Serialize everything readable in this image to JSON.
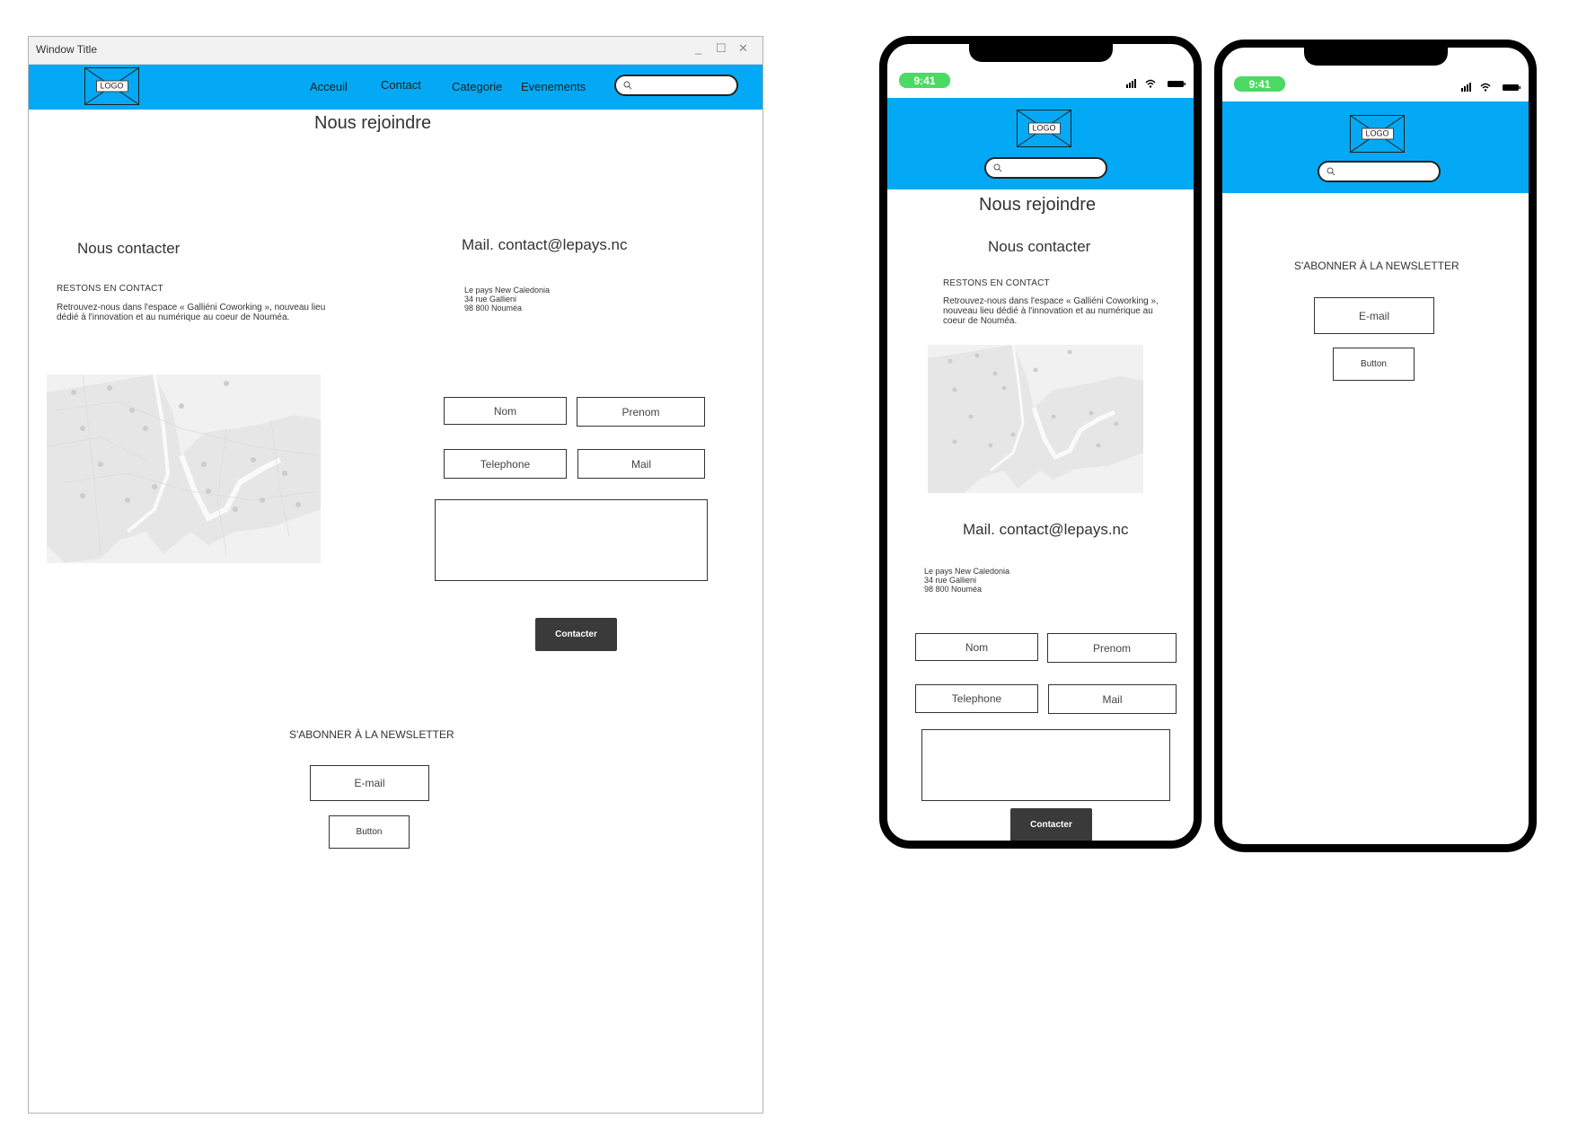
{
  "desktop": {
    "window_title": "Window Title",
    "window_controls": {
      "minimize": "_",
      "maximize": "☐",
      "close": "✕"
    },
    "logo_label": "LOGO",
    "nav": [
      {
        "label": "Acceuil"
      },
      {
        "label": "Contact"
      },
      {
        "label": "Categorie"
      },
      {
        "label": "Evenements"
      }
    ],
    "search": {
      "placeholder": ""
    },
    "page_title": "Nous rejoindre",
    "contact_heading": "Nous contacter",
    "mail_heading": "Mail. contact@lepays.nc",
    "stay_in_touch": "RESTONS EN CONTACT",
    "description": "Retrouvez-nous dans l'espace « Galliéni Coworking », nouveau lieu dédié à l'innovation et au numérique au coeur de Nouméa.",
    "address": [
      "Le pays  New Caledonia",
      "34 rue Gallieni",
      "98 800 Nouméa"
    ],
    "form": {
      "nom": "Nom",
      "prenom": "Prenom",
      "telephone": "Telephone",
      "mail": "Mail",
      "message": "",
      "submit": "Contacter"
    },
    "newsletter": {
      "heading": "S'ABONNER À LA NEWSLETTER",
      "email": "E-mail",
      "button": "Button"
    }
  },
  "phone1": {
    "time": "9:41",
    "logo_label": "LOGO",
    "page_title": "Nous rejoindre",
    "contact_heading": "Nous contacter",
    "stay_in_touch": "RESTONS EN CONTACT",
    "description": "Retrouvez-nous dans l'espace « Galliéni Coworking », nouveau lieu dédié à l'innovation et au numérique au coeur de Nouméa.",
    "mail_heading": "Mail. contact@lepays.nc",
    "address": [
      "Le pays  New Caledonia",
      "34 rue Gallieni",
      "98 800 Nouméa"
    ],
    "form": {
      "nom": "Nom",
      "prenom": "Prenom",
      "telephone": "Telephone",
      "mail": "Mail",
      "submit": "Contacter"
    }
  },
  "phone2": {
    "time": "9:41",
    "logo_label": "LOGO",
    "newsletter": {
      "heading": "S'ABONNER À LA NEWSLETTER",
      "email": "E-mail",
      "button": "Button"
    }
  },
  "colors": {
    "header_blue": "#03a9f4",
    "dark_button": "#3a3a3a",
    "status_green": "#4cd964"
  },
  "icons": {
    "search": "search-icon",
    "logo_placeholder": "image-placeholder-icon",
    "map": "map-placeholder",
    "signal": "signal-icon",
    "wifi": "wifi-icon",
    "battery": "battery-icon"
  }
}
